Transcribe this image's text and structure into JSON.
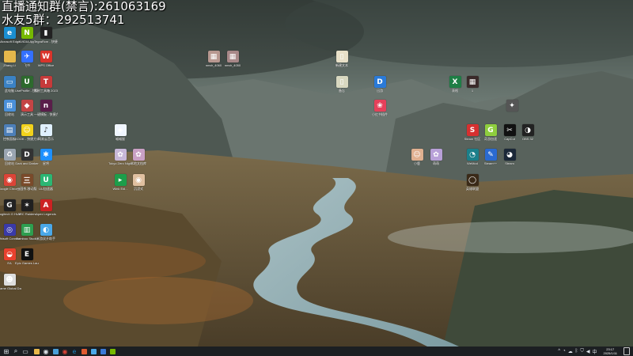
{
  "overlay": {
    "line1": "直播通知群(禁言):261063169",
    "line2": "水友5群：292513741"
  },
  "desktop_icons": [
    {
      "id": "edge",
      "label": "Microsoft Edge",
      "icon": "edge-icon",
      "color": "#1a8fd1",
      "glyph": "e"
    },
    {
      "id": "nvidia",
      "label": "NVIDIA App",
      "icon": "nvidia-icon",
      "color": "#76b900",
      "glyph": "N"
    },
    {
      "id": "switch",
      "label": "TegraRcm - 快捷方式",
      "icon": "switch-icon",
      "color": "#222222",
      "glyph": "▮"
    },
    {
      "id": "zhangli",
      "label": "Zhang Li",
      "icon": "folder-icon",
      "color": "#e5b84b",
      "glyph": ""
    },
    {
      "id": "feishu",
      "label": "飞书",
      "icon": "feishu-icon",
      "color": "#3370ff",
      "glyph": "✈"
    },
    {
      "id": "wps",
      "label": "WPS Office",
      "icon": "wps-icon",
      "color": "#d9342b",
      "glyph": "W"
    },
    {
      "id": "computer",
      "label": "此电脑",
      "icon": "computer-icon",
      "color": "#3b82c4",
      "glyph": "▭"
    },
    {
      "id": "uuprofile",
      "label": "UseProfile - 快捷方式",
      "icon": "app-icon",
      "color": "#2d6a2d",
      "glyph": "U"
    },
    {
      "id": "tool2023",
      "label": "素材工具箱 2023 - 快...",
      "icon": "tool-icon",
      "color": "#c63a3a",
      "glyph": "T"
    },
    {
      "id": "recycle",
      "label": "回收站",
      "icon": "network-icon",
      "color": "#4a90d9",
      "glyph": "⊞"
    },
    {
      "id": "yanshi",
      "label": "演示工具",
      "icon": "game-icon",
      "color": "#c44545",
      "glyph": "◆"
    },
    {
      "id": "onekey",
      "label": "一键模板 - 快捷方式",
      "icon": "onekey-icon",
      "color": "#5a1e4a",
      "glyph": "n"
    },
    {
      "id": "control",
      "label": "控制面板",
      "icon": "control-panel-icon",
      "color": "#4d7fb8",
      "glyph": "▤"
    },
    {
      "id": "kook",
      "label": "KOOK - 快捷方式",
      "icon": "kook-icon",
      "color": "#f2d21b",
      "glyph": "☺"
    },
    {
      "id": "wangyi",
      "label": "网易云音乐",
      "icon": "music-icon",
      "color": "#e0f0ff",
      "glyph": "♪"
    },
    {
      "id": "recyclebin",
      "label": "回收站",
      "icon": "recycle-bin-icon",
      "color": "#9aa5b1",
      "glyph": "♻"
    },
    {
      "id": "darkand",
      "label": "Dark and Darker",
      "icon": "game-icon",
      "color": "#333333",
      "glyph": "D"
    },
    {
      "id": "xingjiang",
      "label": "星将",
      "icon": "star-icon",
      "color": "#1e90ff",
      "glyph": "✱"
    },
    {
      "id": "chrome",
      "label": "Google Chrome",
      "icon": "chrome-icon",
      "color": "#db4437",
      "glyph": "◉"
    },
    {
      "id": "sanguo",
      "label": "三国杀-移动版",
      "icon": "game-icon",
      "color": "#7a4a2a",
      "glyph": "三"
    },
    {
      "id": "uuacc",
      "label": "UU加速器",
      "icon": "uu-icon",
      "color": "#2bb673",
      "glyph": "U"
    },
    {
      "id": "logitech",
      "label": "Logitech G HUB",
      "icon": "logitech-icon",
      "color": "#222222",
      "glyph": "G"
    },
    {
      "id": "arcraiders",
      "label": "ARC Raiders",
      "icon": "arc-icon",
      "color": "#202020",
      "glyph": "✶"
    },
    {
      "id": "apex",
      "label": "Apex Legends",
      "icon": "apex-icon",
      "color": "#cc2222",
      "glyph": "A"
    },
    {
      "id": "ubisoft",
      "label": "Ubisoft Connect",
      "icon": "ubisoft-icon",
      "color": "#3a3aa8",
      "glyph": "◎"
    },
    {
      "id": "bamboo",
      "label": "Bamboo Studio",
      "icon": "bamboo-icon",
      "color": "#2e9e4f",
      "glyph": "▥"
    },
    {
      "id": "shuangkai",
      "label": "米游双开助手",
      "icon": "helper-icon",
      "color": "#4aa8e8",
      "glyph": "◐"
    },
    {
      "id": "ea",
      "label": "EA",
      "icon": "ea-icon",
      "color": "#e8412e",
      "glyph": "◒"
    },
    {
      "id": "epic",
      "label": "Epic Games Launcher",
      "icon": "epic-icon",
      "color": "#111111",
      "glyph": "E"
    },
    {
      "id": "gameglobal",
      "label": "Game Global Data",
      "icon": "person-icon",
      "color": "#dddddd",
      "glyph": "☻"
    },
    {
      "id": "mid1",
      "label": "喵喵屋",
      "icon": "app-icon",
      "color": "#f0f6ff",
      "glyph": "◈"
    },
    {
      "id": "mid2",
      "label": "Tokyo Zero Nightmare",
      "icon": "game-icon",
      "color": "#c7b7d8",
      "glyph": "✿"
    },
    {
      "id": "mid3",
      "label": "本地文档库",
      "icon": "game-icon",
      "color": "#c9a0c4",
      "glyph": "✿"
    },
    {
      "id": "mid4",
      "label": "Wink Edi...",
      "icon": "app-icon",
      "color": "#1c9e4a",
      "glyph": "▸"
    },
    {
      "id": "mid5",
      "label": "沉浸式",
      "icon": "game-icon",
      "color": "#e0c0a0",
      "glyph": "◉"
    },
    {
      "id": "top1",
      "label": "nmdr_4060",
      "icon": "image-icon",
      "color": "#b89890",
      "glyph": "▦"
    },
    {
      "id": "top2",
      "label": "nmdr_4050",
      "icon": "image-icon",
      "color": "#a88888",
      "glyph": "▦"
    },
    {
      "id": "file1",
      "label": "新建文本",
      "icon": "file-icon",
      "color": "#e8e0c8",
      "glyph": "▯"
    },
    {
      "id": "file2",
      "label": "备忘",
      "icon": "file-icon",
      "color": "#d8d8c0",
      "glyph": "▯"
    },
    {
      "id": "app_d",
      "label": "迅游",
      "icon": "app-icon",
      "color": "#2a7ad8",
      "glyph": "D"
    },
    {
      "id": "red_app",
      "label": "小红书插件",
      "icon": "app-icon",
      "color": "#e6405a",
      "glyph": "❀"
    },
    {
      "id": "excel",
      "label": "表格",
      "icon": "excel-icon",
      "color": "#1e7e45",
      "glyph": "X"
    },
    {
      "id": "dark_img",
      "label": "1",
      "icon": "image-icon",
      "color": "#3a2a2a",
      "glyph": "▦"
    },
    {
      "id": "bird",
      "label": "",
      "icon": "bird-icon",
      "color": "#555555",
      "glyph": "✦"
    },
    {
      "id": "r1",
      "label": "Steam 社区",
      "icon": "app-icon",
      "color": "#d63030",
      "glyph": "S"
    },
    {
      "id": "r2",
      "label": "奇游加速",
      "icon": "app-icon",
      "color": "#8fce3e",
      "glyph": "G"
    },
    {
      "id": "r3",
      "label": "CapCut",
      "icon": "capcut-icon",
      "color": "#111111",
      "glyph": "✂"
    },
    {
      "id": "r4",
      "label": "OBS 32",
      "icon": "obs-icon",
      "color": "#222222",
      "glyph": "◑"
    },
    {
      "id": "r5",
      "label": "小鹿",
      "icon": "app-icon",
      "color": "#e0b090",
      "glyph": "☺"
    },
    {
      "id": "r6",
      "label": "萌萌",
      "icon": "app-icon",
      "color": "#b8a0d8",
      "glyph": "✿"
    },
    {
      "id": "r7",
      "label": "WeMod",
      "icon": "app-icon",
      "color": "#1b7f8a",
      "glyph": "◔"
    },
    {
      "id": "r8",
      "label": "Steam++",
      "icon": "app-icon",
      "color": "#2a6ad0",
      "glyph": "✎"
    },
    {
      "id": "r9",
      "label": "Steam",
      "icon": "steam-icon",
      "color": "#1b2838",
      "glyph": "◕"
    },
    {
      "id": "r10",
      "label": "英雄联盟",
      "icon": "lol-icon",
      "color": "#3a2a18",
      "glyph": "◯"
    }
  ],
  "taskbar": {
    "items": [
      {
        "id": "start",
        "icon": "windows-start-icon",
        "glyph": "⊞",
        "color": "#dfe4ea"
      },
      {
        "id": "search",
        "icon": "search-icon",
        "glyph": "⌕",
        "color": "#dfe4ea"
      },
      {
        "id": "taskview",
        "icon": "task-view-icon",
        "glyph": "▭",
        "color": "#dfe4ea"
      },
      {
        "id": "explorer",
        "icon": "file-explorer-icon",
        "glyph": "",
        "color": "#e8b84b"
      },
      {
        "id": "obs",
        "icon": "obs-icon",
        "glyph": "◉",
        "color": "#dfe4ea"
      },
      {
        "id": "app1",
        "icon": "app-icon",
        "glyph": "",
        "color": "#4a9fd8"
      },
      {
        "id": "chrome",
        "icon": "chrome-icon",
        "glyph": "◉",
        "color": "#db4437"
      },
      {
        "id": "edge",
        "icon": "edge-icon",
        "glyph": "e",
        "color": "#1a8fd1"
      },
      {
        "id": "app2",
        "icon": "app-icon",
        "glyph": "",
        "color": "#e05a30"
      },
      {
        "id": "app3",
        "icon": "app-icon",
        "glyph": "",
        "color": "#4aa8e8"
      },
      {
        "id": "app4",
        "icon": "app-icon",
        "glyph": "",
        "color": "#3a7ad8"
      },
      {
        "id": "nvidia",
        "icon": "nvidia-icon",
        "glyph": "",
        "color": "#76b900"
      }
    ],
    "tray": [
      {
        "id": "chevron",
        "icon": "chevron-up-icon",
        "glyph": "^"
      },
      {
        "id": "net",
        "icon": "network-icon",
        "glyph": "◔"
      },
      {
        "id": "cloud",
        "icon": "cloud-icon",
        "glyph": "☁"
      },
      {
        "id": "bt",
        "icon": "bluetooth-icon",
        "glyph": "ᛒ"
      },
      {
        "id": "shield",
        "icon": "shield-icon",
        "glyph": "⛉"
      },
      {
        "id": "volume",
        "icon": "volume-icon",
        "glyph": "◀"
      },
      {
        "id": "ime",
        "icon": "ime-icon",
        "glyph": "中"
      }
    ],
    "time": "23:17",
    "date": "2025/1/11"
  }
}
